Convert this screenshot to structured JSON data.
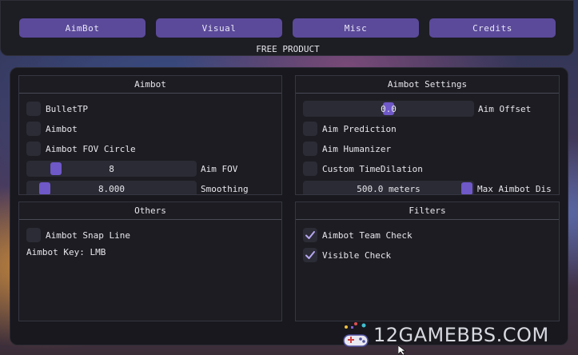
{
  "tabs": [
    {
      "label": "AimBot"
    },
    {
      "label": "Visual"
    },
    {
      "label": "Misc"
    },
    {
      "label": "Credits"
    }
  ],
  "subtitle": "FREE PRODUCT",
  "panels": {
    "aimbot": {
      "title": "Aimbot",
      "checkboxes": [
        {
          "label": "BulletTP",
          "checked": false
        },
        {
          "label": "Aimbot",
          "checked": false
        },
        {
          "label": "Aimbot FOV Circle",
          "checked": false
        }
      ],
      "sliders": [
        {
          "value": "8",
          "label": "Aim FOV",
          "fill": 0.06
        },
        {
          "value": "8.000",
          "label": "Smoothing",
          "fill": 0.02
        }
      ]
    },
    "aimbot_settings": {
      "title": "Aimbot Settings",
      "slider_top": {
        "value": "0.0",
        "label": "Aim Offset",
        "fill": 0.5
      },
      "checkboxes": [
        {
          "label": "Aim Prediction",
          "checked": false
        },
        {
          "label": "Aim Humanizer",
          "checked": false
        },
        {
          "label": "Custom TimeDilation",
          "checked": false
        }
      ],
      "slider_bottom": {
        "value": "500.0 meters",
        "label": "Max Aimbot Dis",
        "fill": 1.0
      }
    },
    "others": {
      "title": "Others",
      "checkboxes": [
        {
          "label": "Aimbot Snap Line",
          "checked": false
        }
      ],
      "key_text": "Aimbot Key: LMB"
    },
    "filters": {
      "title": "Filters",
      "checkboxes": [
        {
          "label": "Aimbot Team Check",
          "checked": true
        },
        {
          "label": "Visible Check",
          "checked": true
        }
      ]
    }
  },
  "watermark": "12GAMEBBS.COM",
  "colors": {
    "accent": "#6f58c8",
    "tab": "#5b4a9a",
    "panel": "#1c1c22",
    "check": "#b7a6f0"
  }
}
